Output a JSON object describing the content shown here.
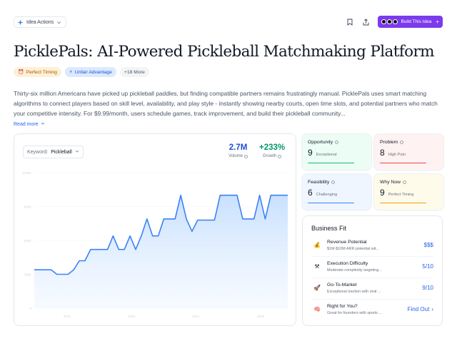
{
  "toolbar": {
    "idea_actions_label": "Idea Actions",
    "build_label": "Build This Idea"
  },
  "page": {
    "title": "PicklePals: AI-Powered Pickleball Matchmaking Platform",
    "tags": [
      "Perfect Timing",
      "Unfair Advantage",
      "+18 More"
    ],
    "description": "Thirty-six million Americans have picked up pickleball paddles, but finding compatible partners remains frustratingly manual. PicklePals uses smart matching algorithms to connect players based on skill level, availability, and play style - instantly showing nearby courts, open time slots, and potential partners who match your competitive intensity. For $9.99/month, users schedule games, track improvement, and build their pickleball community...",
    "read_more": "Read more"
  },
  "trend": {
    "keyword_label": "Keyword:",
    "keyword_value": "Pickleball",
    "volume_value": "2.7M",
    "volume_label": "Volume",
    "growth_value": "+233%",
    "growth_label": "Growth"
  },
  "chart_data": {
    "type": "area",
    "y_tick_labels": [
      "0",
      "300K",
      "600K",
      "900K",
      "1200K"
    ],
    "x_tick_labels": [
      "2022",
      "2023",
      "2024",
      "2025"
    ],
    "ylim": [
      0,
      1200
    ],
    "line_color": "#3b82f6",
    "values": [
      340,
      340,
      340,
      340,
      300,
      300,
      300,
      340,
      420,
      420,
      520,
      520,
      520,
      520,
      640,
      520,
      520,
      640,
      520,
      640,
      790,
      640,
      640,
      790,
      790,
      790,
      1000,
      790,
      680,
      780,
      780,
      780,
      780,
      1000,
      1000,
      1000,
      1000,
      790,
      790,
      790,
      1000,
      790,
      1000,
      1000,
      1000,
      1000
    ]
  },
  "metrics": [
    {
      "title": "Opportunity",
      "score": "9",
      "sub": "Exceptional"
    },
    {
      "title": "Problem",
      "score": "8",
      "sub": "High Pain"
    },
    {
      "title": "Feasibility",
      "score": "6",
      "sub": "Challenging"
    },
    {
      "title": "Why Now",
      "score": "9",
      "sub": "Perfect Timing"
    }
  ],
  "business_fit": {
    "title": "Business Fit",
    "rows": [
      {
        "icon": "💰",
        "name": "Revenue Potential",
        "sub": "$1M-$10M ARR potential wit...",
        "value": "$$$"
      },
      {
        "icon": "⚒",
        "name": "Execution Difficulty",
        "sub": "Moderate complexity targeting...",
        "value": "5/10"
      },
      {
        "icon": "🚀",
        "name": "Go-To-Market",
        "sub": "Exceptional traction with viral ...",
        "value": "9/10"
      },
      {
        "icon": "🧠",
        "name": "Right for You?",
        "sub": "Great for founders with sports ...",
        "value": "Find Out"
      }
    ]
  }
}
